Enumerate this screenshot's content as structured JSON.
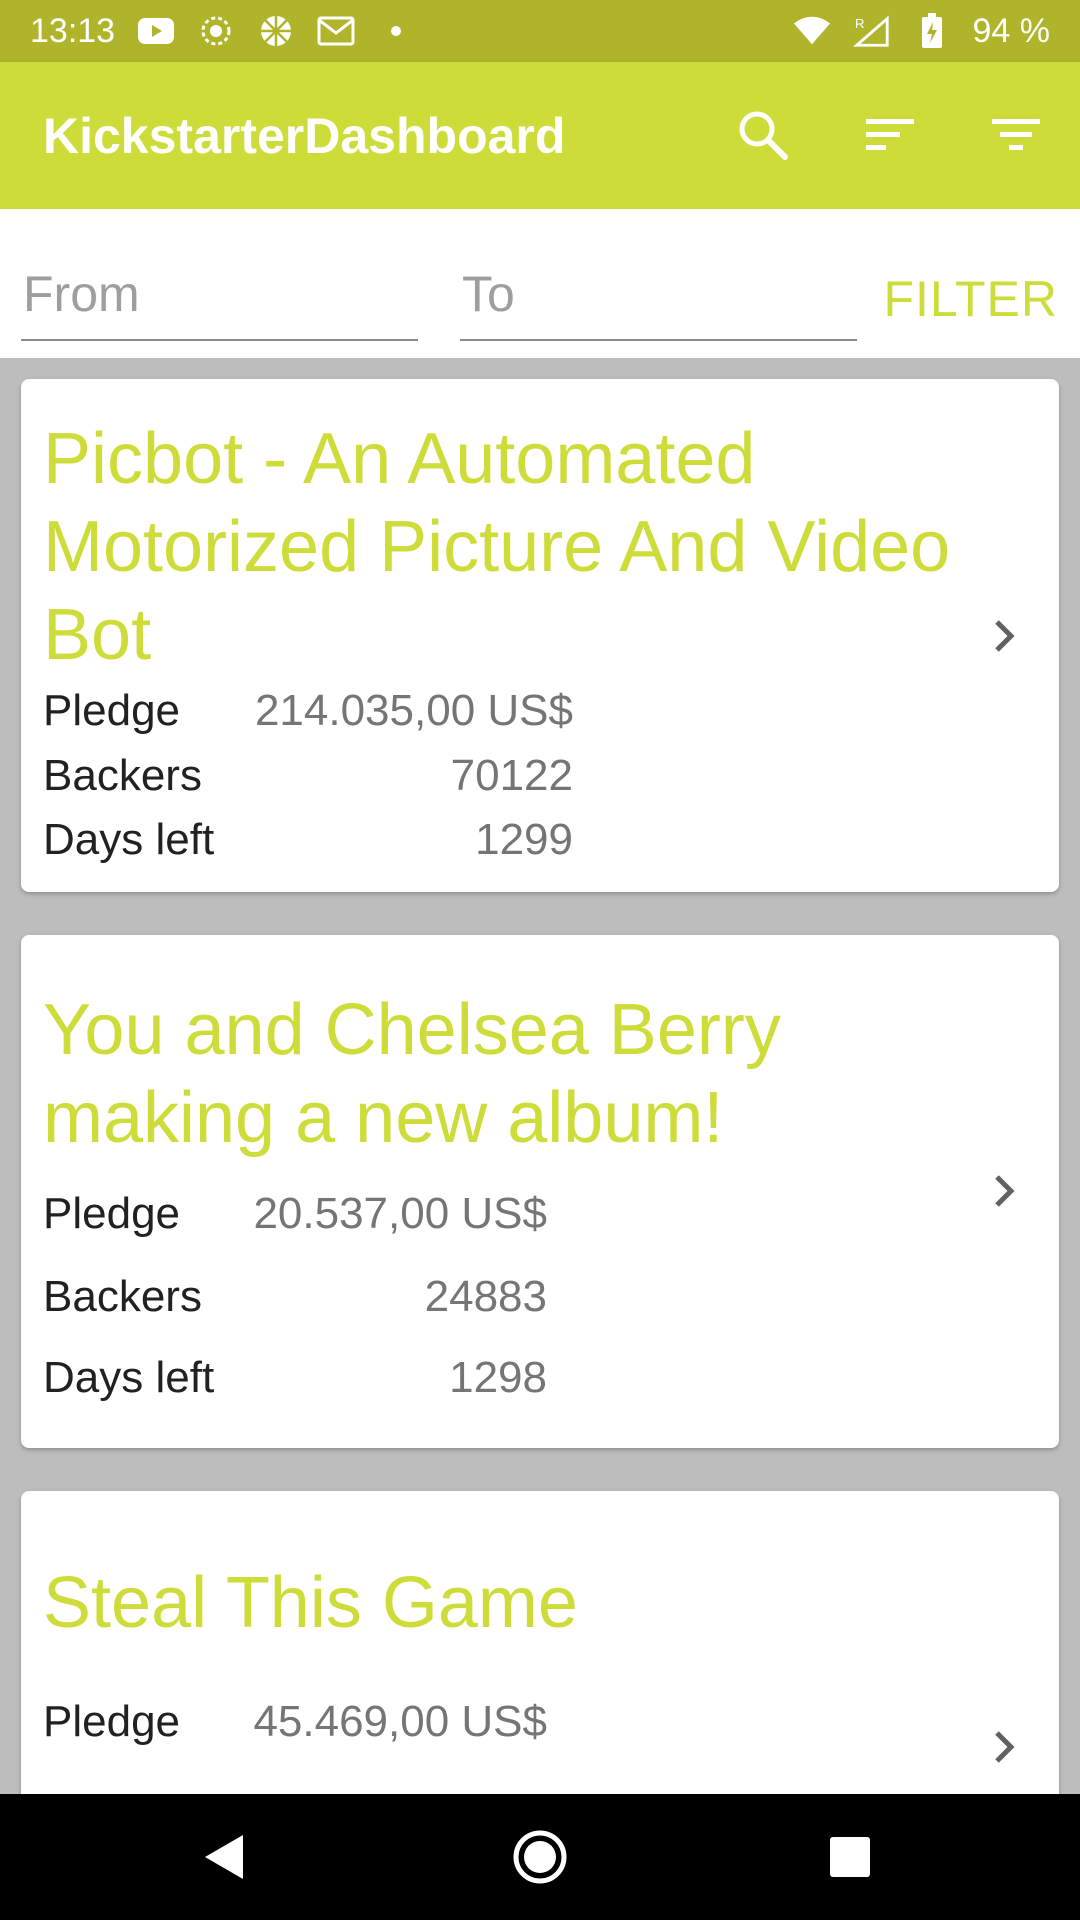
{
  "status_bar": {
    "time": "13:13",
    "battery": "94 %",
    "left_icons": [
      "youtube-icon",
      "lion-app-icon",
      "pinwheel-app-icon",
      "gmail-icon",
      "dot-icon"
    ],
    "right_icons": [
      "wifi-icon",
      "signal-roaming-icon",
      "battery-charging-icon"
    ]
  },
  "app_bar": {
    "title": "KickstarterDashboard",
    "actions": [
      "search-icon",
      "sort-icon",
      "filter-icon"
    ]
  },
  "filter": {
    "from_placeholder": "From",
    "to_placeholder": "To",
    "from_value": "",
    "to_value": "",
    "button_label": "FILTER"
  },
  "projects": [
    {
      "title": "Picbot - An Automated Motorized Picture And Video Bot",
      "pledge_label": "Pledge",
      "pledge_value": "214.035,00 US$",
      "backers_label": "Backers",
      "backers_value": "70122",
      "days_label": "Days left",
      "days_value": "1299"
    },
    {
      "title": "You and Chelsea Berry making a new album!",
      "pledge_label": "Pledge",
      "pledge_value": "20.537,00 US$",
      "backers_label": "Backers",
      "backers_value": "24883",
      "days_label": "Days left",
      "days_value": "1298"
    },
    {
      "title": "Steal This Game",
      "pledge_label": "Pledge",
      "pledge_value": "45.469,00 US$"
    }
  ],
  "nav_bar": [
    "back-icon",
    "home-icon",
    "recents-icon"
  ],
  "colors": {
    "status_bar": "#afb42b",
    "accent": "#cddc39",
    "background": "#bdbdbd",
    "card": "#ffffff"
  }
}
